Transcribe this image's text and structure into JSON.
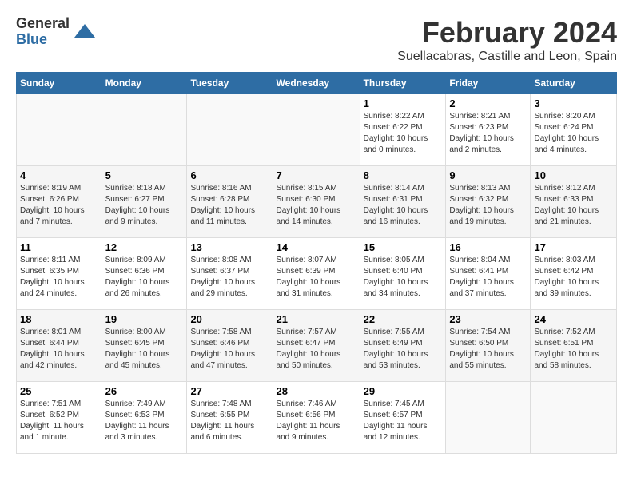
{
  "logo": {
    "general": "General",
    "blue": "Blue"
  },
  "header": {
    "month": "February 2024",
    "location": "Suellacabras, Castille and Leon, Spain"
  },
  "weekdays": [
    "Sunday",
    "Monday",
    "Tuesday",
    "Wednesday",
    "Thursday",
    "Friday",
    "Saturday"
  ],
  "weeks": [
    [
      {
        "day": "",
        "info": ""
      },
      {
        "day": "",
        "info": ""
      },
      {
        "day": "",
        "info": ""
      },
      {
        "day": "",
        "info": ""
      },
      {
        "day": "1",
        "info": "Sunrise: 8:22 AM\nSunset: 6:22 PM\nDaylight: 10 hours\nand 0 minutes."
      },
      {
        "day": "2",
        "info": "Sunrise: 8:21 AM\nSunset: 6:23 PM\nDaylight: 10 hours\nand 2 minutes."
      },
      {
        "day": "3",
        "info": "Sunrise: 8:20 AM\nSunset: 6:24 PM\nDaylight: 10 hours\nand 4 minutes."
      }
    ],
    [
      {
        "day": "4",
        "info": "Sunrise: 8:19 AM\nSunset: 6:26 PM\nDaylight: 10 hours\nand 7 minutes."
      },
      {
        "day": "5",
        "info": "Sunrise: 8:18 AM\nSunset: 6:27 PM\nDaylight: 10 hours\nand 9 minutes."
      },
      {
        "day": "6",
        "info": "Sunrise: 8:16 AM\nSunset: 6:28 PM\nDaylight: 10 hours\nand 11 minutes."
      },
      {
        "day": "7",
        "info": "Sunrise: 8:15 AM\nSunset: 6:30 PM\nDaylight: 10 hours\nand 14 minutes."
      },
      {
        "day": "8",
        "info": "Sunrise: 8:14 AM\nSunset: 6:31 PM\nDaylight: 10 hours\nand 16 minutes."
      },
      {
        "day": "9",
        "info": "Sunrise: 8:13 AM\nSunset: 6:32 PM\nDaylight: 10 hours\nand 19 minutes."
      },
      {
        "day": "10",
        "info": "Sunrise: 8:12 AM\nSunset: 6:33 PM\nDaylight: 10 hours\nand 21 minutes."
      }
    ],
    [
      {
        "day": "11",
        "info": "Sunrise: 8:11 AM\nSunset: 6:35 PM\nDaylight: 10 hours\nand 24 minutes."
      },
      {
        "day": "12",
        "info": "Sunrise: 8:09 AM\nSunset: 6:36 PM\nDaylight: 10 hours\nand 26 minutes."
      },
      {
        "day": "13",
        "info": "Sunrise: 8:08 AM\nSunset: 6:37 PM\nDaylight: 10 hours\nand 29 minutes."
      },
      {
        "day": "14",
        "info": "Sunrise: 8:07 AM\nSunset: 6:39 PM\nDaylight: 10 hours\nand 31 minutes."
      },
      {
        "day": "15",
        "info": "Sunrise: 8:05 AM\nSunset: 6:40 PM\nDaylight: 10 hours\nand 34 minutes."
      },
      {
        "day": "16",
        "info": "Sunrise: 8:04 AM\nSunset: 6:41 PM\nDaylight: 10 hours\nand 37 minutes."
      },
      {
        "day": "17",
        "info": "Sunrise: 8:03 AM\nSunset: 6:42 PM\nDaylight: 10 hours\nand 39 minutes."
      }
    ],
    [
      {
        "day": "18",
        "info": "Sunrise: 8:01 AM\nSunset: 6:44 PM\nDaylight: 10 hours\nand 42 minutes."
      },
      {
        "day": "19",
        "info": "Sunrise: 8:00 AM\nSunset: 6:45 PM\nDaylight: 10 hours\nand 45 minutes."
      },
      {
        "day": "20",
        "info": "Sunrise: 7:58 AM\nSunset: 6:46 PM\nDaylight: 10 hours\nand 47 minutes."
      },
      {
        "day": "21",
        "info": "Sunrise: 7:57 AM\nSunset: 6:47 PM\nDaylight: 10 hours\nand 50 minutes."
      },
      {
        "day": "22",
        "info": "Sunrise: 7:55 AM\nSunset: 6:49 PM\nDaylight: 10 hours\nand 53 minutes."
      },
      {
        "day": "23",
        "info": "Sunrise: 7:54 AM\nSunset: 6:50 PM\nDaylight: 10 hours\nand 55 minutes."
      },
      {
        "day": "24",
        "info": "Sunrise: 7:52 AM\nSunset: 6:51 PM\nDaylight: 10 hours\nand 58 minutes."
      }
    ],
    [
      {
        "day": "25",
        "info": "Sunrise: 7:51 AM\nSunset: 6:52 PM\nDaylight: 11 hours\nand 1 minute."
      },
      {
        "day": "26",
        "info": "Sunrise: 7:49 AM\nSunset: 6:53 PM\nDaylight: 11 hours\nand 3 minutes."
      },
      {
        "day": "27",
        "info": "Sunrise: 7:48 AM\nSunset: 6:55 PM\nDaylight: 11 hours\nand 6 minutes."
      },
      {
        "day": "28",
        "info": "Sunrise: 7:46 AM\nSunset: 6:56 PM\nDaylight: 11 hours\nand 9 minutes."
      },
      {
        "day": "29",
        "info": "Sunrise: 7:45 AM\nSunset: 6:57 PM\nDaylight: 11 hours\nand 12 minutes."
      },
      {
        "day": "",
        "info": ""
      },
      {
        "day": "",
        "info": ""
      }
    ]
  ]
}
